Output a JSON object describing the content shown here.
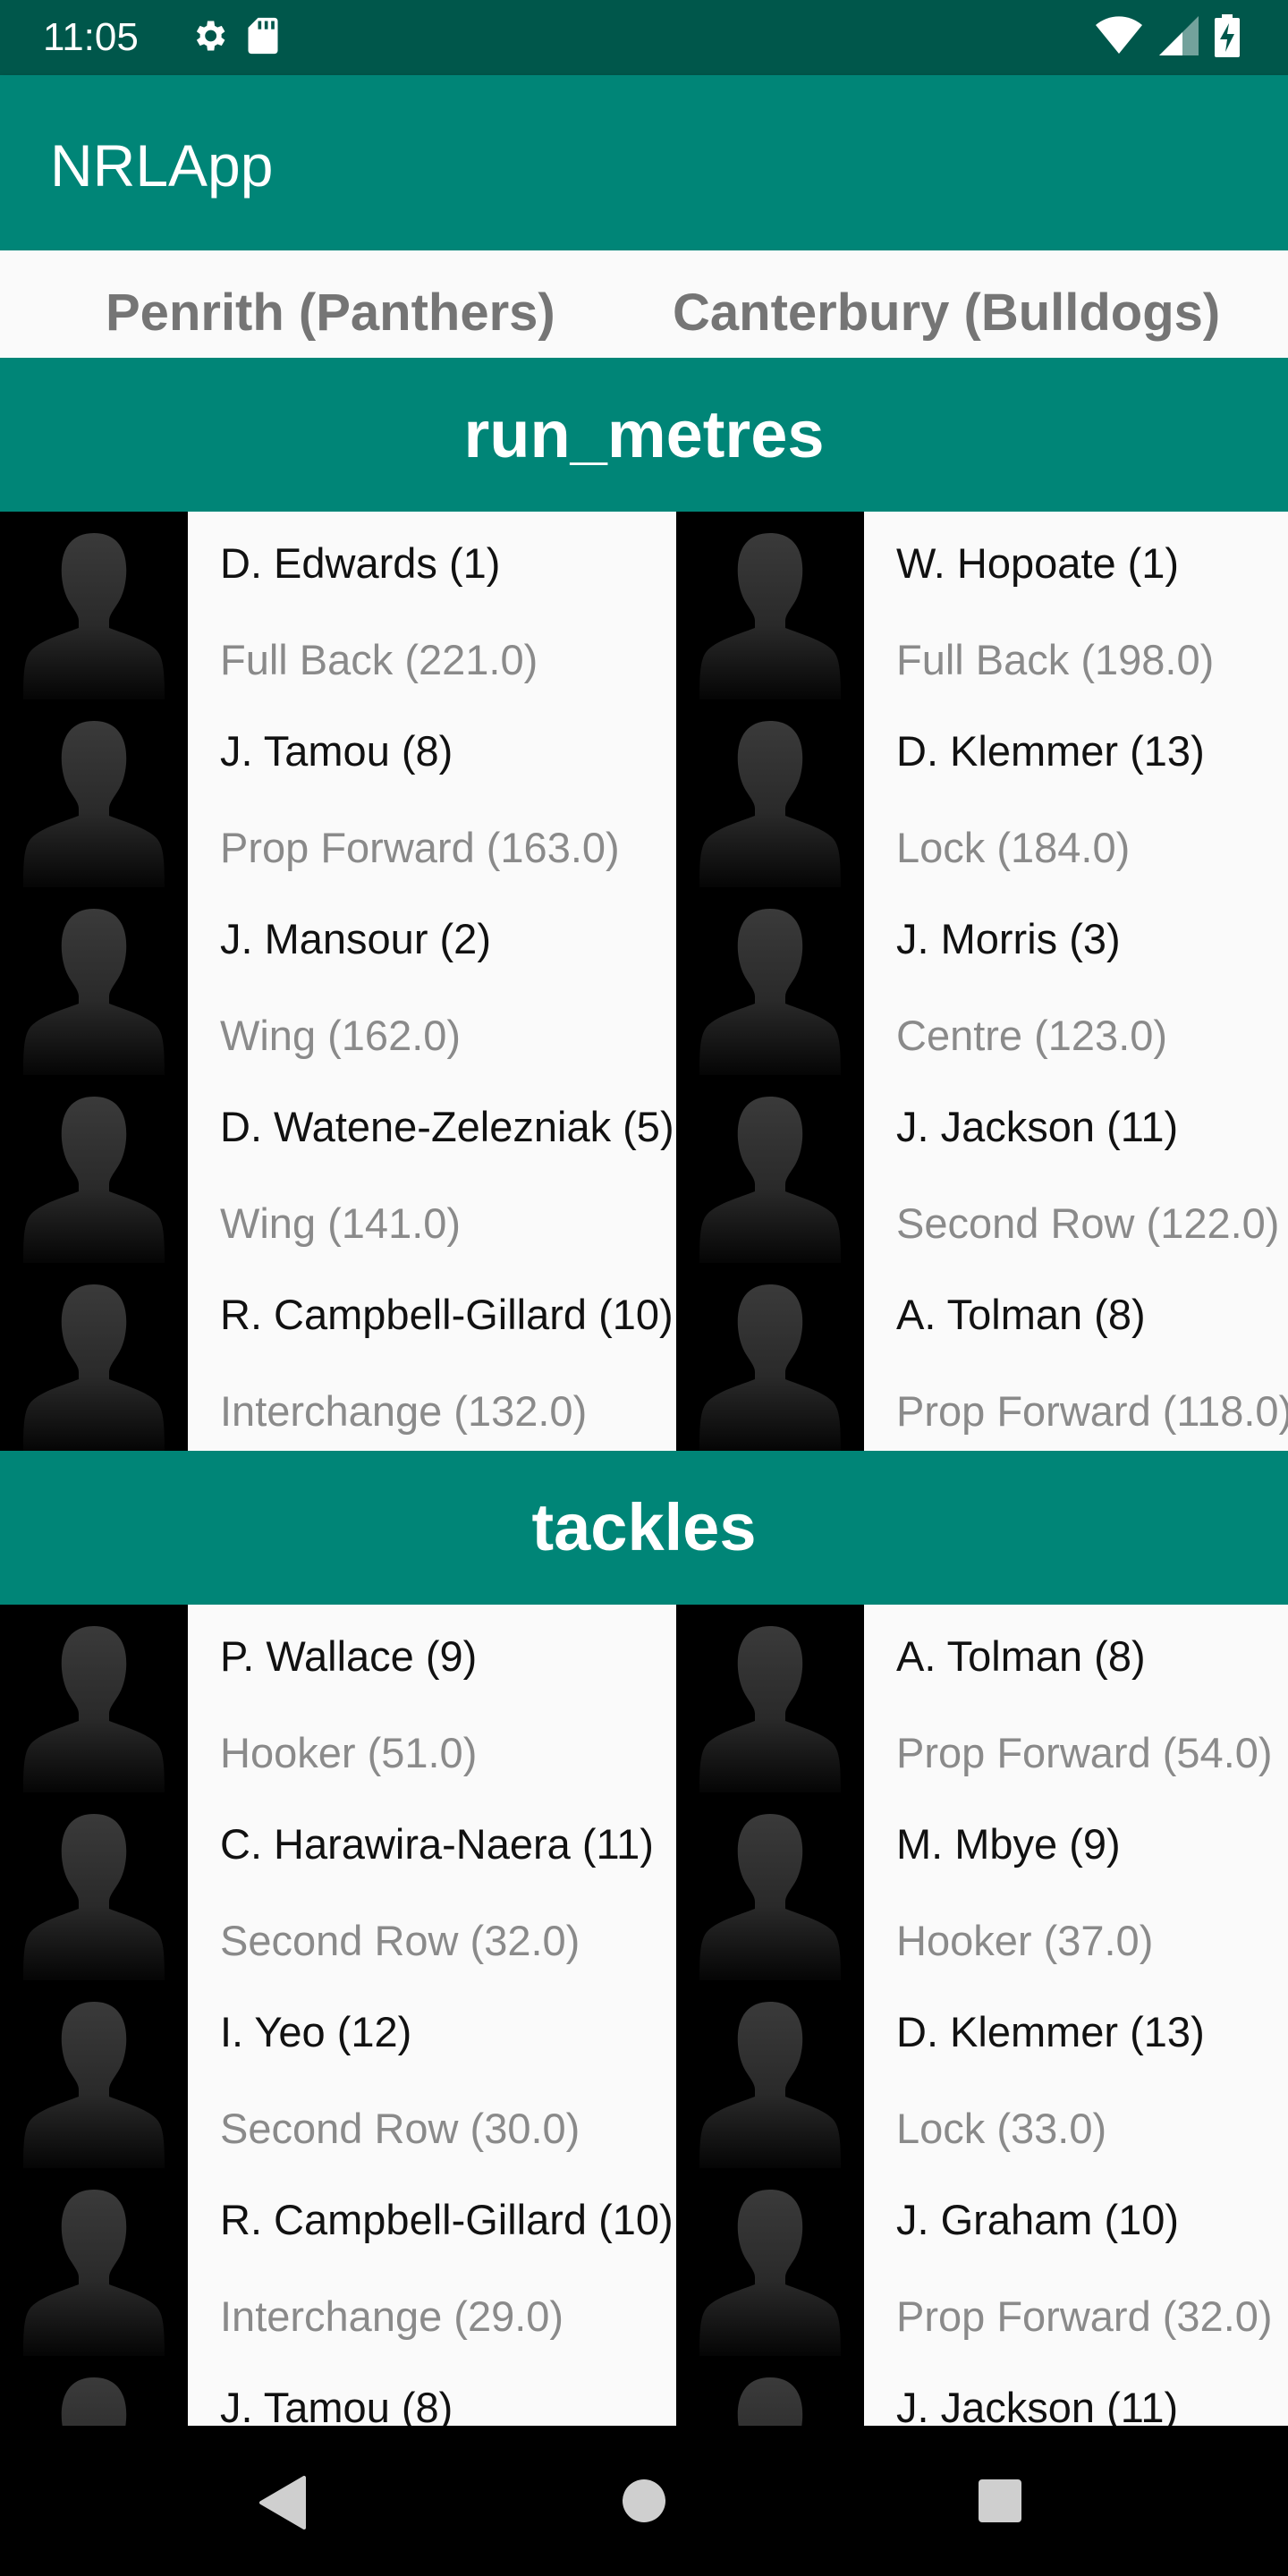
{
  "status_bar": {
    "time": "11:05",
    "icons": [
      "settings-icon",
      "sd-card-icon",
      "wifi-icon",
      "cell-signal-icon",
      "battery-charging-icon"
    ]
  },
  "app_bar": {
    "title": "NRLApp"
  },
  "teams": {
    "home": "Penrith (Panthers)",
    "away": "Canterbury (Bulldogs)"
  },
  "sections": [
    {
      "title": "run_metres",
      "home_players": [
        {
          "name": "D. Edwards (1)",
          "detail": "Full Back (221.0)"
        },
        {
          "name": "J. Tamou (8)",
          "detail": "Prop Forward (163.0)"
        },
        {
          "name": "J. Mansour (2)",
          "detail": "Wing (162.0)"
        },
        {
          "name": "D. Watene-Zelezniak (5)",
          "detail": "Wing (141.0)"
        },
        {
          "name": "R. Campbell-Gillard (10)",
          "detail": "Interchange (132.0)"
        }
      ],
      "away_players": [
        {
          "name": "W. Hopoate (1)",
          "detail": "Full Back (198.0)"
        },
        {
          "name": "D. Klemmer (13)",
          "detail": "Lock (184.0)"
        },
        {
          "name": "J. Morris (3)",
          "detail": "Centre (123.0)"
        },
        {
          "name": "J. Jackson (11)",
          "detail": "Second Row (122.0)"
        },
        {
          "name": "A. Tolman (8)",
          "detail": "Prop Forward (118.0)"
        }
      ]
    },
    {
      "title": "tackles",
      "home_players": [
        {
          "name": "P. Wallace (9)",
          "detail": "Hooker (51.0)"
        },
        {
          "name": "C. Harawira-Naera (11)",
          "detail": "Second Row (32.0)"
        },
        {
          "name": "I. Yeo (12)",
          "detail": "Second Row (30.0)"
        },
        {
          "name": "R. Campbell-Gillard (10)",
          "detail": "Interchange (29.0)"
        },
        {
          "name": "J. Tamou (8)",
          "detail": ""
        }
      ],
      "away_players": [
        {
          "name": "A. Tolman (8)",
          "detail": "Prop Forward (54.0)"
        },
        {
          "name": "M. Mbye (9)",
          "detail": "Hooker (37.0)"
        },
        {
          "name": "D. Klemmer (13)",
          "detail": "Lock (33.0)"
        },
        {
          "name": "J. Graham (10)",
          "detail": "Prop Forward (32.0)"
        },
        {
          "name": "J. Jackson (11)",
          "detail": ""
        }
      ]
    }
  ],
  "nav_bar": {
    "icons": [
      "back-icon",
      "home-icon",
      "recents-icon"
    ]
  },
  "colors": {
    "status_bar": "#00574b",
    "primary": "#008577",
    "list_background": "#fafafa",
    "secondary_text": "#8a8a8a"
  }
}
